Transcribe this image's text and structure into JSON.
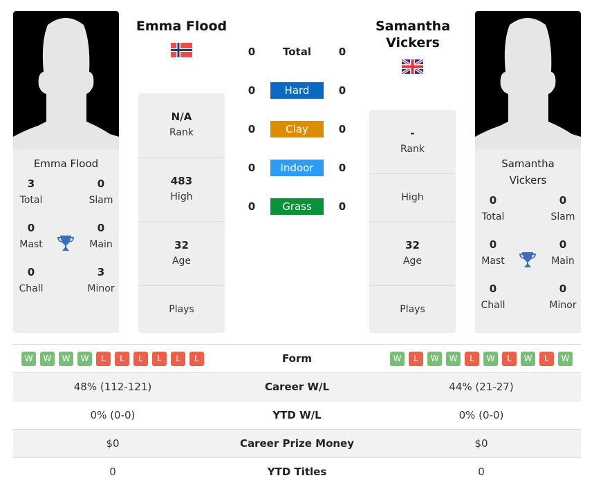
{
  "colors": {
    "hard": "#0a69c2",
    "clay": "#de8c06",
    "indoor": "#2c9cf5",
    "grass": "#0a9239",
    "win": "#77bf77",
    "loss": "#ef5f47",
    "trophy": "#3a6ebf"
  },
  "player1": {
    "name": "Emma Flood",
    "flag": "norway-flag",
    "card_name": "Emma Flood",
    "titles": {
      "total": {
        "value": "3",
        "label": "Total"
      },
      "slam": {
        "value": "0",
        "label": "Slam"
      },
      "mast": {
        "value": "0",
        "label": "Mast"
      },
      "main": {
        "value": "0",
        "label": "Main"
      },
      "chall": {
        "value": "0",
        "label": "Chall"
      },
      "minor": {
        "value": "3",
        "label": "Minor"
      }
    },
    "info": {
      "rank": {
        "value": "N/A",
        "label": "Rank"
      },
      "high": {
        "value": "483",
        "label": "High"
      },
      "age": {
        "value": "32",
        "label": "Age"
      },
      "plays": {
        "value": "",
        "label": "Plays"
      }
    },
    "form": [
      "W",
      "W",
      "W",
      "W",
      "L",
      "L",
      "L",
      "L",
      "L",
      "L"
    ],
    "career_wl": "48% (112-121)",
    "ytd_wl": "0% (0-0)",
    "prize_money": "$0",
    "ytd_titles": "0"
  },
  "player2": {
    "name": "Samantha Vickers",
    "flag": "uk-flag",
    "card_name": "Samantha Vickers",
    "titles": {
      "total": {
        "value": "0",
        "label": "Total"
      },
      "slam": {
        "value": "0",
        "label": "Slam"
      },
      "mast": {
        "value": "0",
        "label": "Mast"
      },
      "main": {
        "value": "0",
        "label": "Main"
      },
      "chall": {
        "value": "0",
        "label": "Chall"
      },
      "minor": {
        "value": "0",
        "label": "Minor"
      }
    },
    "info": {
      "rank": {
        "value": "-",
        "label": "Rank"
      },
      "high": {
        "value": "",
        "label": "High"
      },
      "age": {
        "value": "32",
        "label": "Age"
      },
      "plays": {
        "value": "",
        "label": "Plays"
      }
    },
    "form": [
      "W",
      "L",
      "W",
      "W",
      "L",
      "W",
      "L",
      "W",
      "L",
      "W"
    ],
    "career_wl": "44% (21-27)",
    "ytd_wl": "0% (0-0)",
    "prize_money": "$0",
    "ytd_titles": "0"
  },
  "h2h": {
    "total": {
      "label": "Total",
      "p1": "0",
      "p2": "0"
    },
    "hard": {
      "label": "Hard",
      "p1": "0",
      "p2": "0"
    },
    "clay": {
      "label": "Clay",
      "p1": "0",
      "p2": "0"
    },
    "indoor": {
      "label": "Indoor",
      "p1": "0",
      "p2": "0"
    },
    "grass": {
      "label": "Grass",
      "p1": "0",
      "p2": "0"
    }
  },
  "stats_labels": {
    "form": "Form",
    "career_wl": "Career W/L",
    "ytd_wl": "YTD W/L",
    "prize_money": "Career Prize Money",
    "ytd_titles": "YTD Titles"
  }
}
